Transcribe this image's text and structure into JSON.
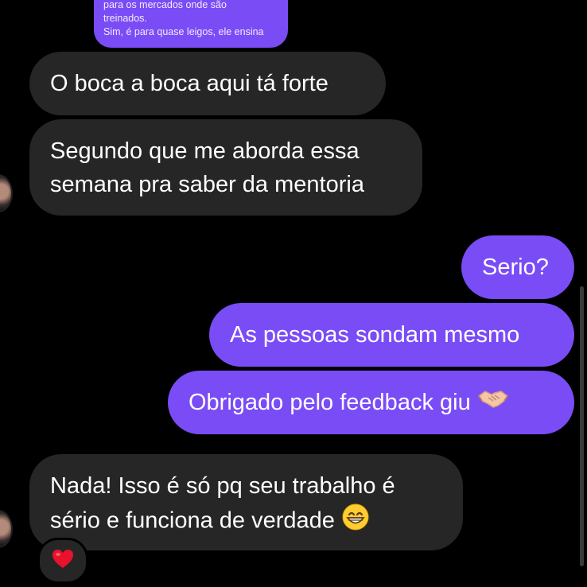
{
  "reply_preview": {
    "lines": [
      "para os mercados onde são",
      "treinados.",
      "Sim, é para quase leigos, ele ensina"
    ]
  },
  "messages": [
    {
      "direction": "incoming",
      "lines": [
        "O boca a boca aqui tá forte"
      ]
    },
    {
      "direction": "incoming",
      "lines": [
        "Segundo que me aborda essa",
        "semana pra saber da mentoria"
      ]
    },
    {
      "direction": "outgoing",
      "lines": [
        "Serio?"
      ]
    },
    {
      "direction": "outgoing",
      "lines": [
        "As pessoas sondam mesmo"
      ]
    },
    {
      "direction": "outgoing",
      "lines": [
        "Obrigado pelo feedback giu"
      ],
      "emoji": "handshake-icon"
    },
    {
      "direction": "incoming",
      "lines": [
        "Nada! Isso é só pq seu trabalho é",
        "sério e funciona de verdade"
      ],
      "emoji": "grinning-face-icon",
      "reaction": "red-heart-icon"
    }
  ],
  "colors": {
    "background": "#000000",
    "incoming_bubble": "#262626",
    "outgoing_bubble": "#7a4cf6",
    "text": "#ffffff"
  }
}
